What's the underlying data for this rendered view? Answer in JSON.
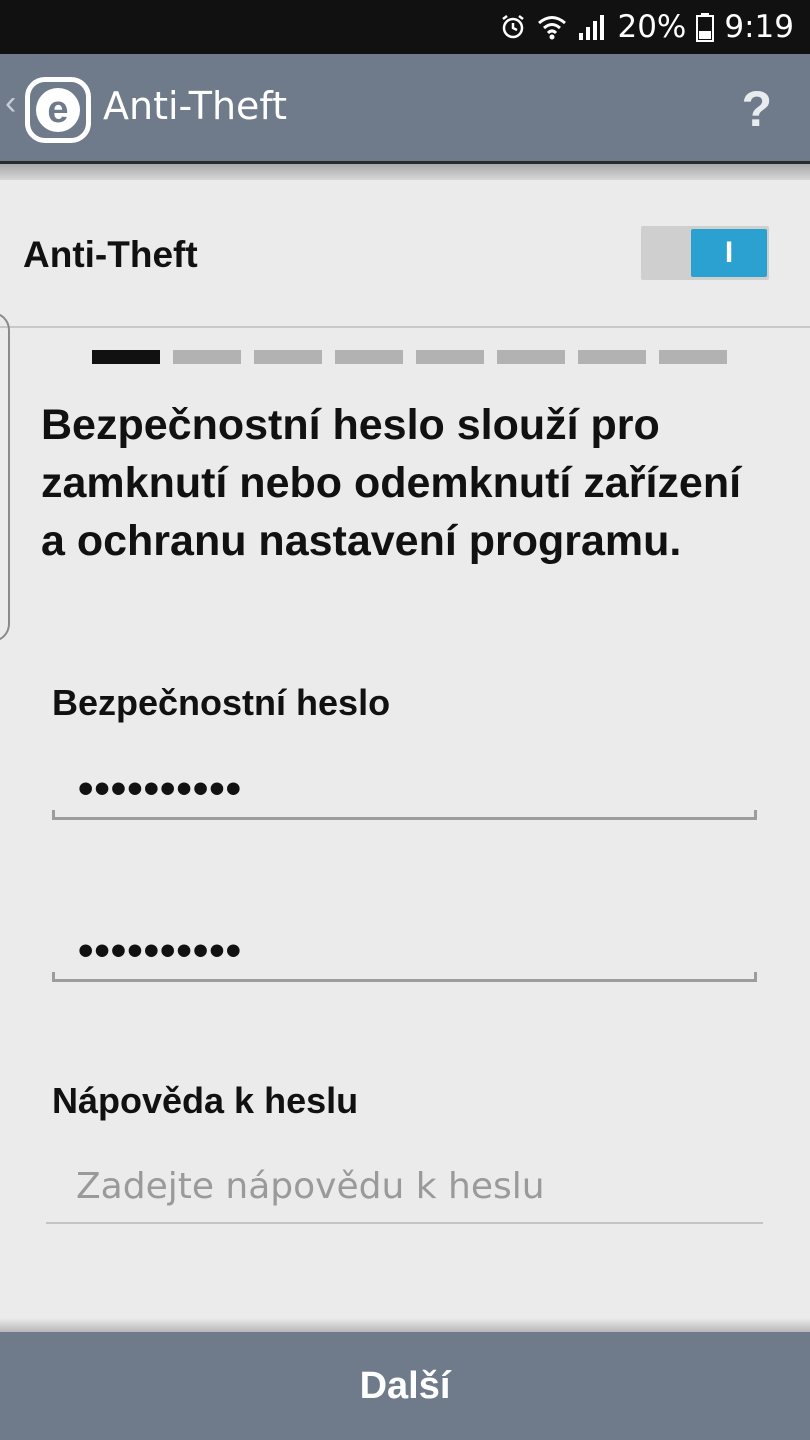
{
  "status_bar": {
    "battery_percent": "20%",
    "time": "9:19",
    "icons": [
      "alarm-icon",
      "wifi-icon",
      "signal-icon",
      "battery-icon"
    ]
  },
  "action_bar": {
    "back_glyph": "‹",
    "logo_letter": "e",
    "title": "Anti-Theft",
    "help_glyph": "?"
  },
  "toggle": {
    "label": "Anti-Theft",
    "state_glyph": "I",
    "on": true,
    "on_color": "#2aa1d1"
  },
  "steps": {
    "total": 8,
    "current": 1
  },
  "headline": "Bezpečnostní heslo slouží pro zamknutí nebo odemknutí zařízení a ochranu nastavení programu.",
  "password": {
    "label": "Bezpečnostní heslo",
    "value": "••••••••••",
    "confirm_value": "••••••••••"
  },
  "hint": {
    "label": "Nápověda k heslu",
    "placeholder": "Zadejte nápovědu k heslu"
  },
  "next_button": {
    "label": "Další"
  },
  "colors": {
    "bar": "#6f7b8b",
    "background": "#ebebeb",
    "accent": "#2aa1d1"
  }
}
